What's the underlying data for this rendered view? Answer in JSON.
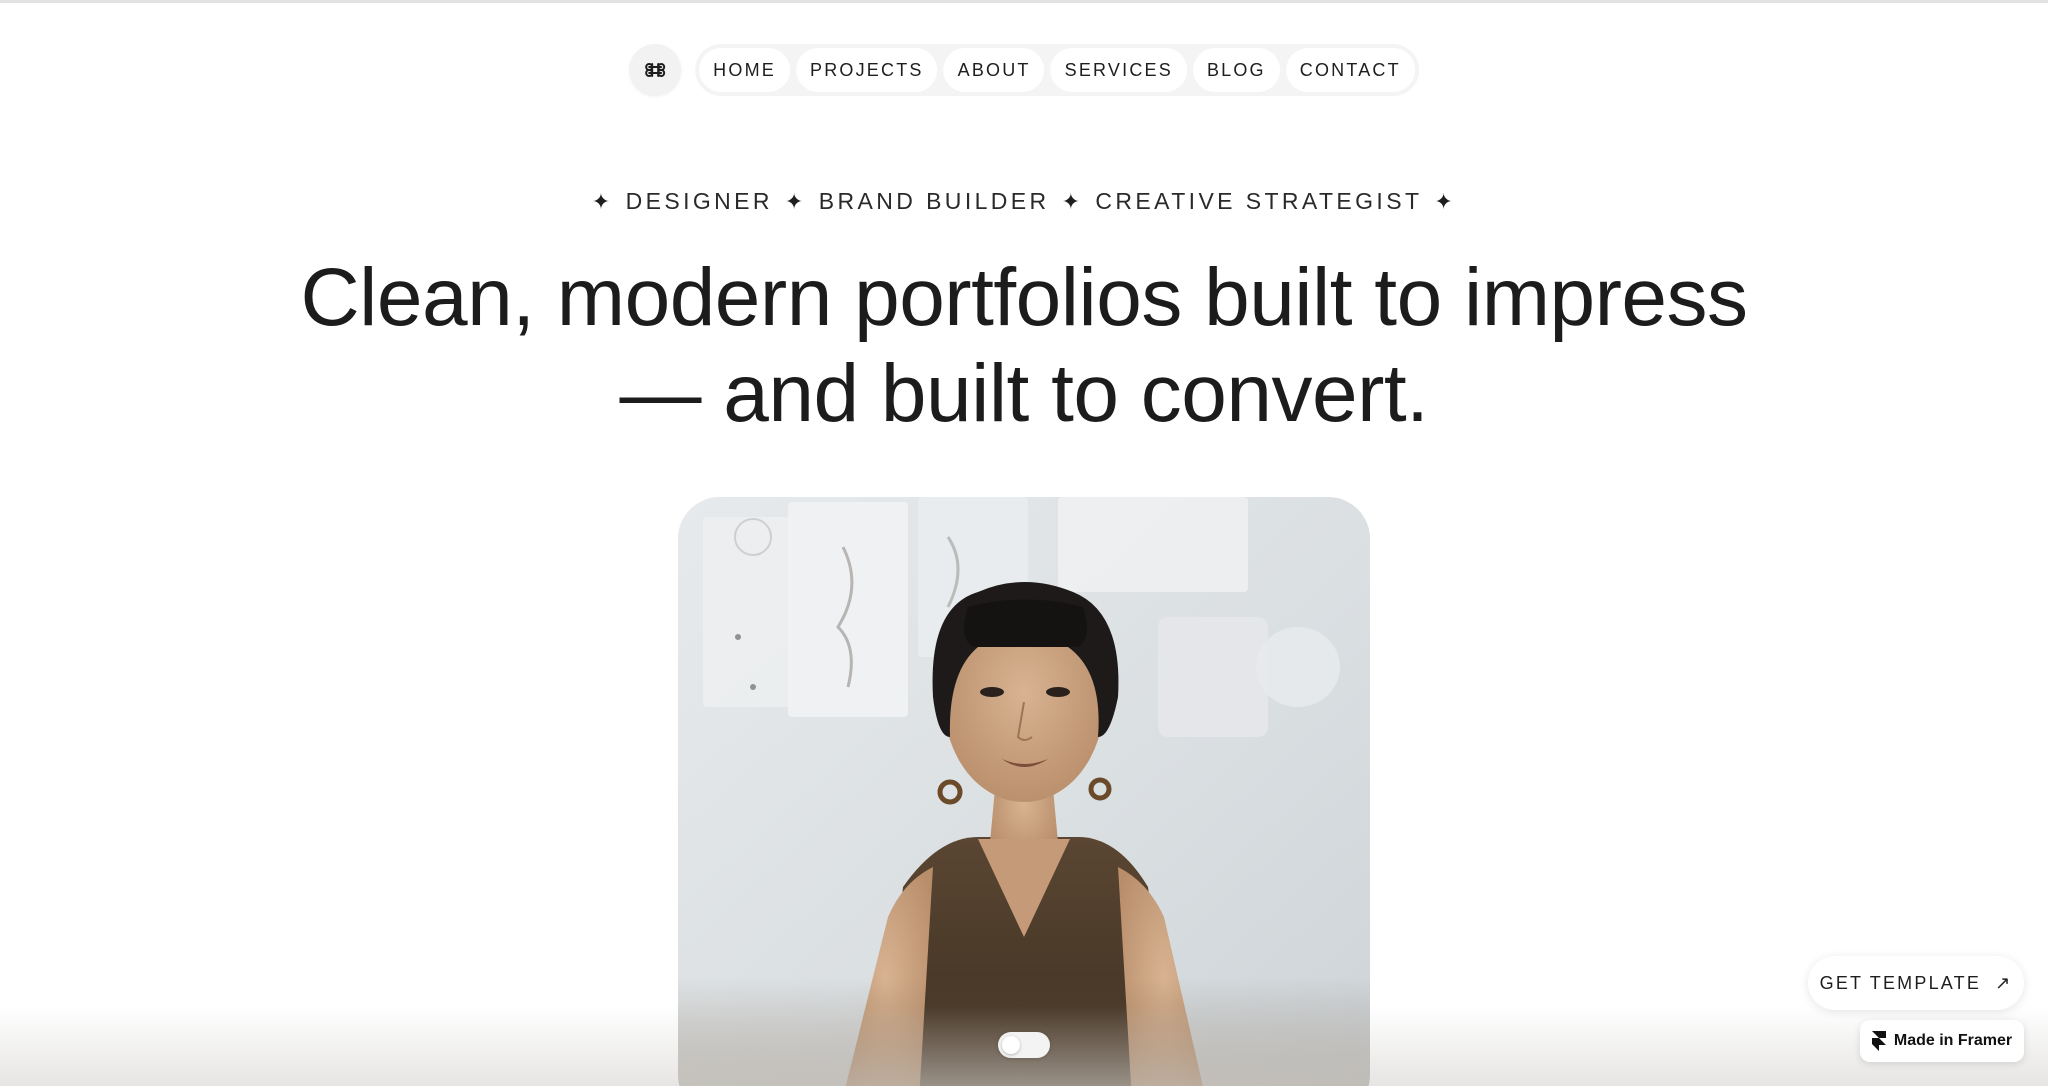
{
  "nav": {
    "logo_icon": "cmd-icon",
    "items": [
      {
        "label": "HOME"
      },
      {
        "label": "PROJECTS"
      },
      {
        "label": "ABOUT"
      },
      {
        "label": "SERVICES"
      },
      {
        "label": "BLOG"
      },
      {
        "label": "CONTACT"
      }
    ]
  },
  "hero": {
    "tagline": [
      "DESIGNER",
      "BRAND BUILDER",
      "CREATIVE STRATEGIST"
    ],
    "tagline_separator_icon": "sparkle-icon",
    "headline_line1": "Clean, modern portfolios built to impress",
    "headline_line2": "— and built to convert."
  },
  "floating": {
    "get_template_label": "GET TEMPLATE",
    "get_template_icon": "arrow-up-right-icon",
    "framer_label": "Made in Framer",
    "framer_icon": "framer-logo-icon"
  },
  "colors": {
    "text": "#1c1c1c",
    "background": "#ffffff",
    "nav_pill": "#f4f4f4"
  }
}
